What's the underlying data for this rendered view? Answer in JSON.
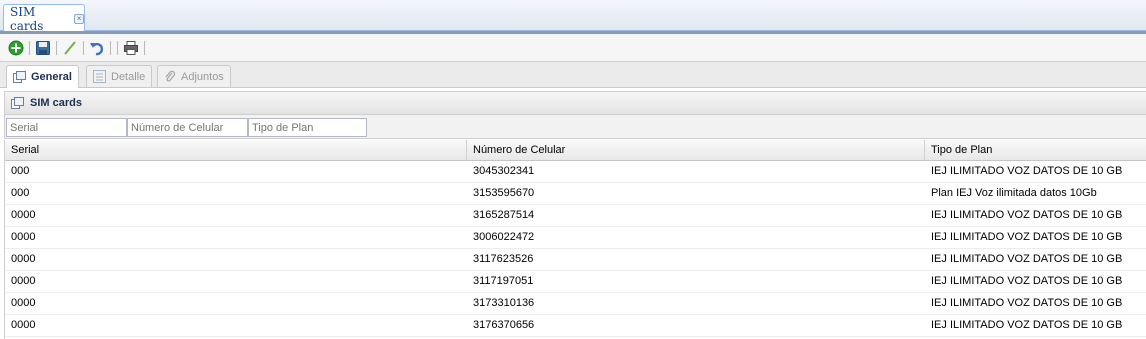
{
  "main_tab": {
    "label": "SIM cards"
  },
  "toolbar": {
    "buttons": [
      {
        "icon": "add-icon"
      },
      {
        "icon": "save-icon"
      },
      {
        "icon": "edit-icon"
      },
      {
        "icon": "undo-icon"
      },
      {
        "icon": "print-icon"
      }
    ]
  },
  "subtabs": [
    {
      "label": "General",
      "icon": "form-icon",
      "active": true
    },
    {
      "label": "Detalle",
      "icon": "detail-icon",
      "active": false
    },
    {
      "label": "Adjuntos",
      "icon": "paperclip-icon",
      "active": false
    }
  ],
  "panel": {
    "title": "SIM cards"
  },
  "filters": {
    "serial": {
      "placeholder": "Serial",
      "value": ""
    },
    "numero": {
      "placeholder": "Número de Celular",
      "value": ""
    },
    "tipo": {
      "placeholder": "Tipo de Plan",
      "value": ""
    }
  },
  "grid": {
    "columns": [
      "Serial",
      "Número de Celular",
      "Tipo de Plan"
    ],
    "rows": [
      [
        "000",
        "3045302341",
        "IEJ ILIMITADO VOZ DATOS DE 10 GB"
      ],
      [
        "000",
        "3153595670",
        "Plan IEJ Voz ilimitada datos 10Gb"
      ],
      [
        "0000",
        "3165287514",
        "IEJ ILIMITADO VOZ DATOS DE 10 GB"
      ],
      [
        "0000",
        "3006022472",
        "IEJ ILIMITADO VOZ DATOS DE 10 GB"
      ],
      [
        "0000",
        "3117623526",
        "IEJ ILIMITADO VOZ DATOS DE 10 GB"
      ],
      [
        "0000",
        "3117197051",
        "IEJ ILIMITADO VOZ DATOS DE 10 GB"
      ],
      [
        "0000",
        "3173310136",
        "IEJ ILIMITADO VOZ DATOS DE 10 GB"
      ],
      [
        "0000",
        "3176370656",
        "IEJ ILIMITADO VOZ DATOS DE 10 GB"
      ]
    ]
  },
  "colors": {
    "accent": "#15428b",
    "add_green": "#2e9e2e",
    "save_blue": "#3a6ea5",
    "undo_blue": "#3b6fc4"
  }
}
